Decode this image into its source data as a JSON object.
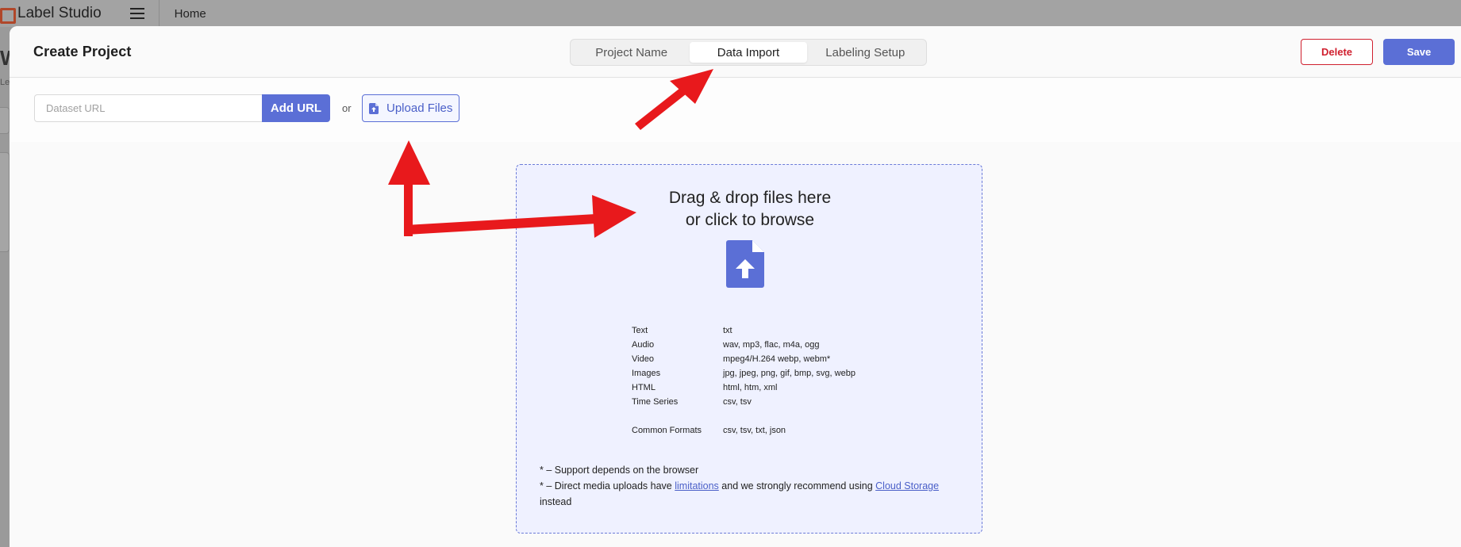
{
  "app": {
    "name": "Label Studio",
    "breadcrumb": "Home"
  },
  "background": {
    "heading_fragment": "W",
    "subtext_fragment": "Le"
  },
  "modal": {
    "title": "Create Project",
    "tabs": [
      {
        "label": "Project Name",
        "active": false
      },
      {
        "label": "Data Import",
        "active": true
      },
      {
        "label": "Labeling Setup",
        "active": false
      }
    ],
    "delete_label": "Delete",
    "save_label": "Save"
  },
  "import": {
    "url_placeholder": "Dataset URL",
    "url_value": "",
    "add_url_label": "Add URL",
    "or_label": "or",
    "upload_label": "Upload Files"
  },
  "dropzone": {
    "title_line1": "Drag & drop files here",
    "title_line2": "or click to browse",
    "formats": [
      {
        "type": "Text",
        "ext": "txt"
      },
      {
        "type": "Audio",
        "ext": "wav, mp3, flac, m4a, ogg"
      },
      {
        "type": "Video",
        "ext": "mpeg4/H.264 webp, webm*"
      },
      {
        "type": "Images",
        "ext": "jpg, jpeg, png, gif, bmp, svg, webp"
      },
      {
        "type": "HTML",
        "ext": "html, htm, xml"
      },
      {
        "type": "Time Series",
        "ext": "csv, tsv"
      }
    ],
    "common_formats": {
      "type": "Common Formats",
      "ext": "csv, tsv, txt, json"
    },
    "note1": "* – Support depends on the browser",
    "note2_prefix": "* – Direct media uploads have ",
    "note2_link1": "limitations",
    "note2_middle": " and we strongly recommend using ",
    "note2_link2": "Cloud Storage",
    "note2_suffix": " instead"
  },
  "colors": {
    "accent": "#5b6fd6",
    "danger": "#d0202f",
    "annotation_arrow": "#e8191c",
    "dropzone_bg": "#eff1ff"
  },
  "icons": {
    "logo": "label-studio-logo-icon",
    "menu": "hamburger-menu-icon",
    "upload_button": "file-upload-icon",
    "dropzone": "file-upload-icon"
  }
}
